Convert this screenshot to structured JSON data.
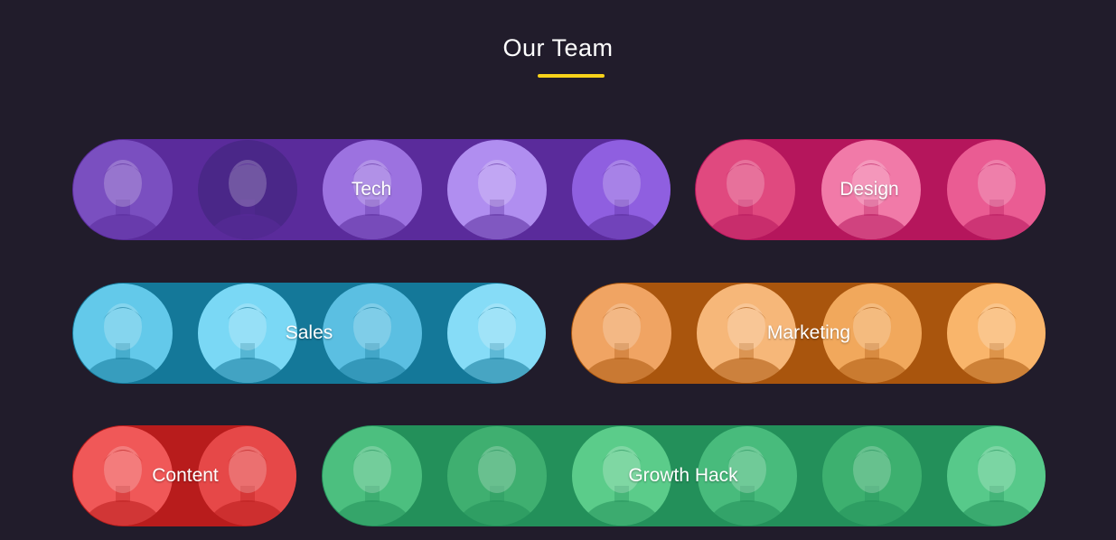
{
  "header": {
    "title": "Our Team"
  },
  "teams": [
    {
      "label": "Tech",
      "color": "#5a2b9b",
      "avatar_tints": [
        "#7a4fc0",
        "#4a2788",
        "#9c72e0",
        "#b08ef0",
        "#8f5fe0"
      ]
    },
    {
      "label": "Design",
      "color": "#b5165c",
      "avatar_tints": [
        "#e0497f",
        "#f17aa8",
        "#ea5c93"
      ]
    },
    {
      "label": "Sales",
      "color": "#147899",
      "avatar_tints": [
        "#63c9ea",
        "#7ad8f5",
        "#5bbfe2",
        "#86dcf7"
      ]
    },
    {
      "label": "Marketing",
      "color": "#a9550d",
      "avatar_tints": [
        "#f0a463",
        "#f6b779",
        "#f1a85c",
        "#f9b56b"
      ]
    },
    {
      "label": "Content",
      "color": "#b81c1c",
      "avatar_tints": [
        "#f05858",
        "#e64848"
      ]
    },
    {
      "label": "Growth Hack",
      "color": "#23905a",
      "avatar_tints": [
        "#4cbf7f",
        "#3faf70",
        "#5bcc8a",
        "#48bb7c",
        "#3db06f",
        "#57c98a"
      ]
    }
  ]
}
